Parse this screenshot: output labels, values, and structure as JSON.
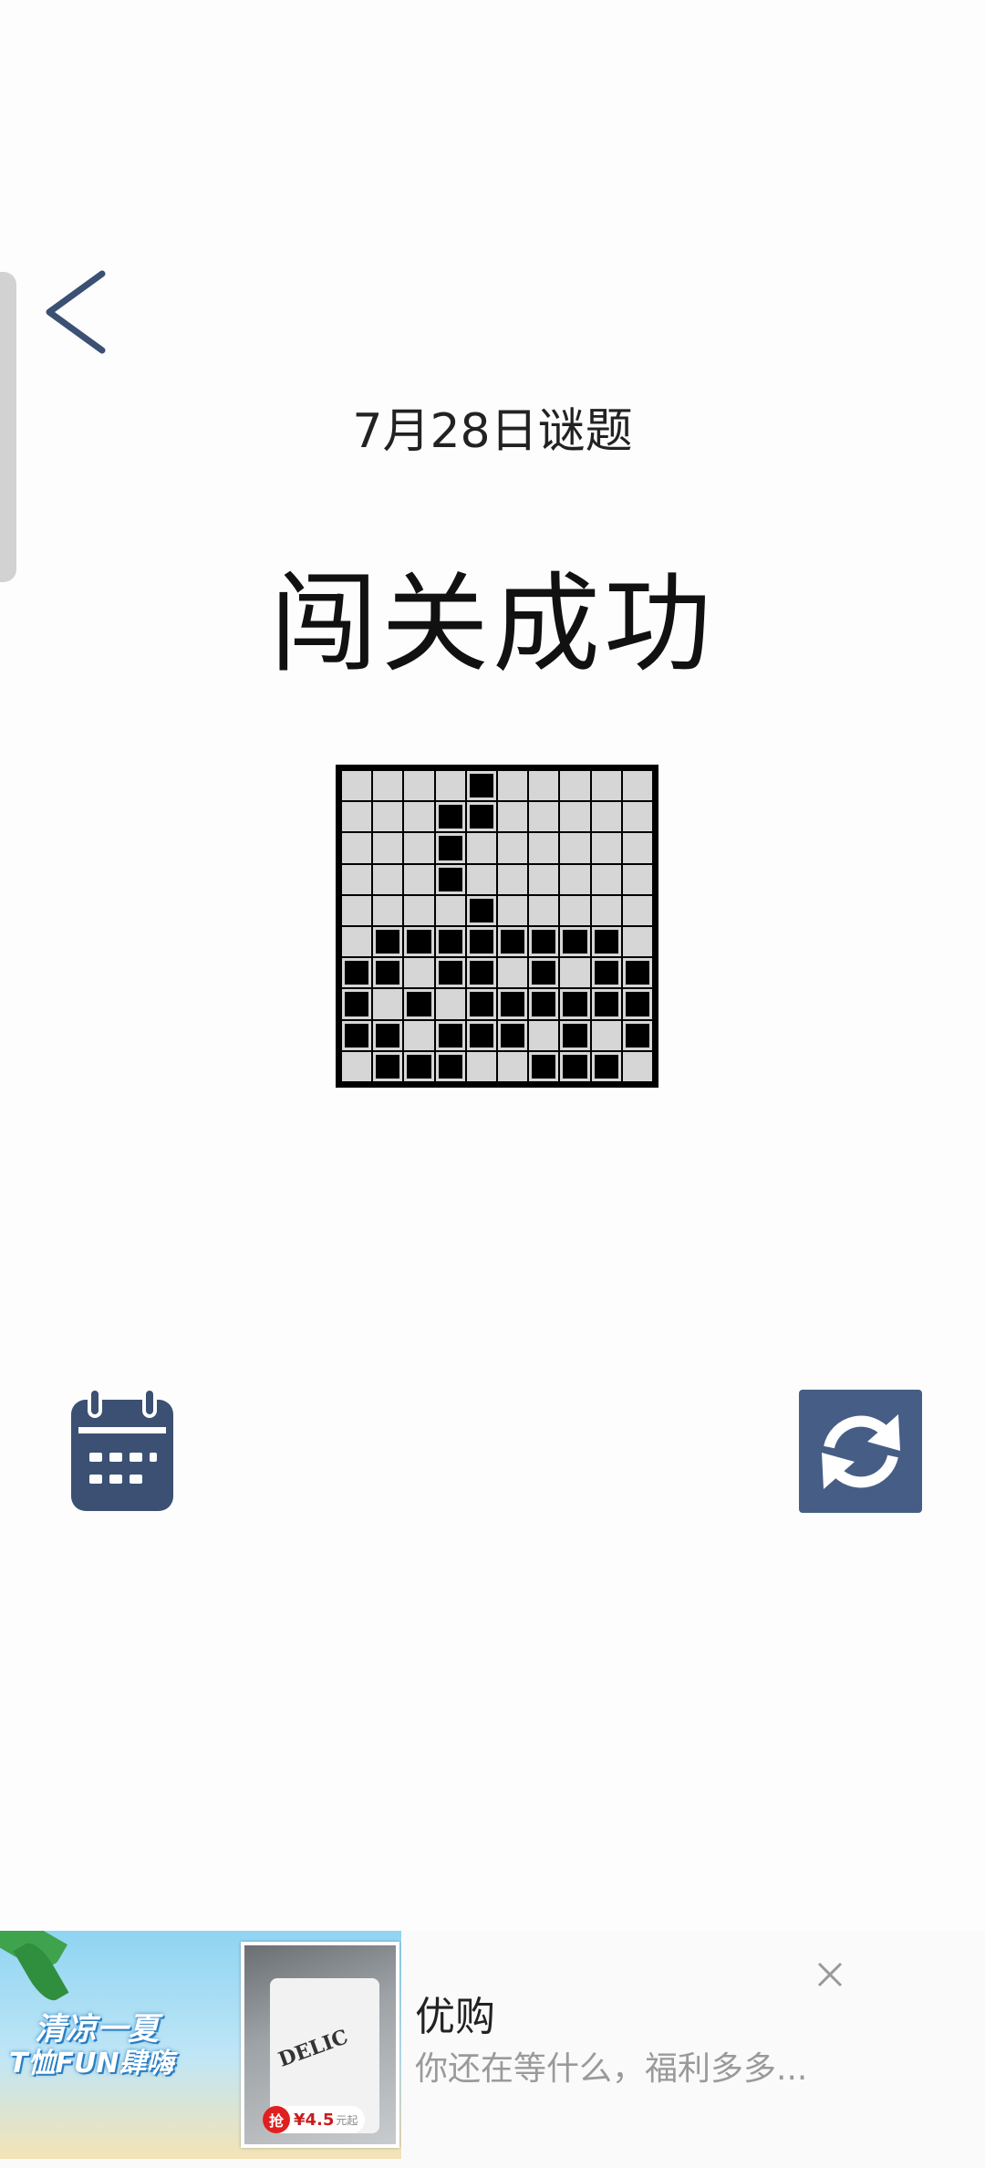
{
  "header": {
    "back_icon": "chevron-left-icon",
    "puzzle_date": "7月28日谜题",
    "status": "闯关成功"
  },
  "board": {
    "rows": 10,
    "cols": 10,
    "grid": [
      [
        0,
        0,
        0,
        0,
        1,
        0,
        0,
        0,
        0,
        0
      ],
      [
        0,
        0,
        0,
        1,
        1,
        0,
        0,
        0,
        0,
        0
      ],
      [
        0,
        0,
        0,
        1,
        0,
        0,
        0,
        0,
        0,
        0
      ],
      [
        0,
        0,
        0,
        1,
        0,
        0,
        0,
        0,
        0,
        0
      ],
      [
        0,
        0,
        0,
        0,
        1,
        0,
        0,
        0,
        0,
        0
      ],
      [
        0,
        1,
        1,
        1,
        1,
        1,
        1,
        1,
        1,
        0
      ],
      [
        1,
        1,
        0,
        1,
        1,
        0,
        1,
        0,
        1,
        1
      ],
      [
        1,
        0,
        1,
        0,
        1,
        1,
        1,
        1,
        1,
        1
      ],
      [
        1,
        1,
        0,
        1,
        1,
        1,
        0,
        1,
        0,
        1
      ],
      [
        0,
        1,
        1,
        1,
        0,
        0,
        1,
        1,
        1,
        0
      ]
    ],
    "filled_color": "#000000",
    "empty_color": "#d6d6d6"
  },
  "controls": {
    "calendar_icon": "calendar-icon",
    "refresh_icon": "refresh-icon",
    "accent_color": "#3b5072"
  },
  "ad": {
    "slogan_line1": "清凉一夏",
    "slogan_line2": "T恤FUN肆嗨",
    "price_badge": "抢",
    "price": "¥4.5",
    "price_unit": "元起",
    "shirt_print": "DELIC",
    "name": "优购",
    "description": "你还在等什么，福利多多...",
    "close_icon": "close-icon"
  }
}
